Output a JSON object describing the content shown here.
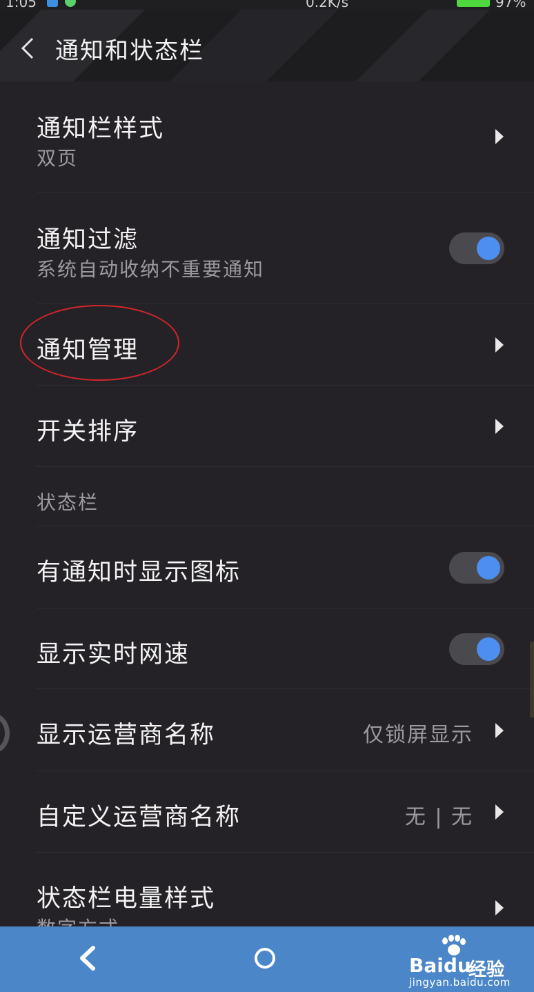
{
  "status_bar": {
    "time": "1:05",
    "network_speed": "0.2K/s",
    "battery": "97%"
  },
  "header": {
    "title": "通知和状态栏"
  },
  "settings": {
    "notification_style": {
      "label": "通知栏样式",
      "sub": "双页"
    },
    "notification_filter": {
      "label": "通知过滤",
      "sub": "系统自动收纳不重要通知",
      "enabled": true
    },
    "notification_management": {
      "label": "通知管理"
    },
    "switch_order": {
      "label": "开关排序"
    }
  },
  "status_section": {
    "header": "状态栏",
    "show_icon": {
      "label": "有通知时显示图标",
      "enabled": true
    },
    "realtime_speed": {
      "label": "显示实时网速",
      "enabled": true
    },
    "carrier_name": {
      "label": "显示运营商名称",
      "value": "仅锁屏显示"
    },
    "custom_carrier": {
      "label": "自定义运营商名称",
      "value": "无 | 无"
    },
    "battery_style": {
      "label": "状态栏电量样式",
      "sub": "数字方式"
    }
  },
  "watermark": {
    "brand": "Baidu",
    "brand_cn": "经验",
    "url": "jingyan.baidu.com"
  },
  "colors": {
    "background": "#242226",
    "toggle_knob": "#4d8ff0",
    "navbar": "#4a86c8",
    "annotation": "#d3262c"
  }
}
